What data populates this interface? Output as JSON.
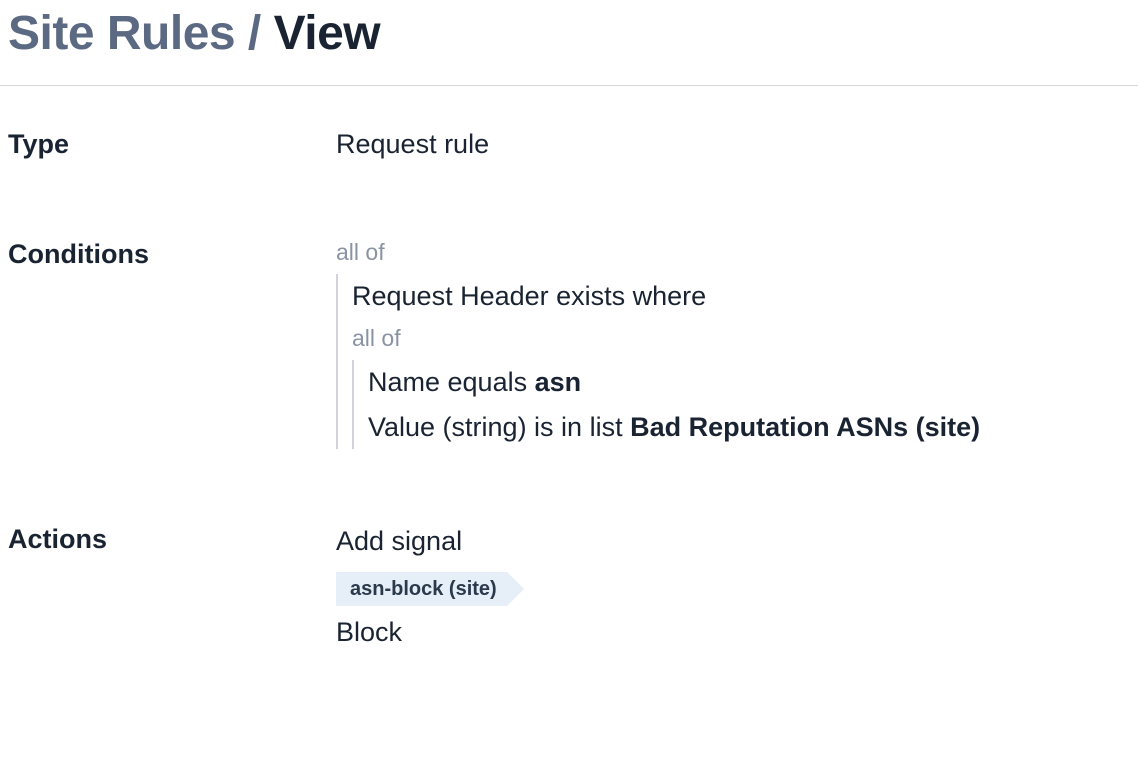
{
  "breadcrumb": {
    "parent": "Site Rules",
    "separator": " / ",
    "current": "View"
  },
  "fields": {
    "type_label": "Type",
    "type_value": "Request rule",
    "conditions_label": "Conditions",
    "actions_label": "Actions"
  },
  "conditions": {
    "quantifier": "all of",
    "line1_prefix": "Request Header exists where",
    "inner_quantifier": "all of",
    "name_line_prefix": "Name equals ",
    "name_value": "asn",
    "value_line_prefix": "Value (string) is in list ",
    "value_list": "Bad Reputation ASNs (site)"
  },
  "actions": {
    "add_signal": "Add signal",
    "signal_tag": "asn-block (site)",
    "block": "Block"
  }
}
